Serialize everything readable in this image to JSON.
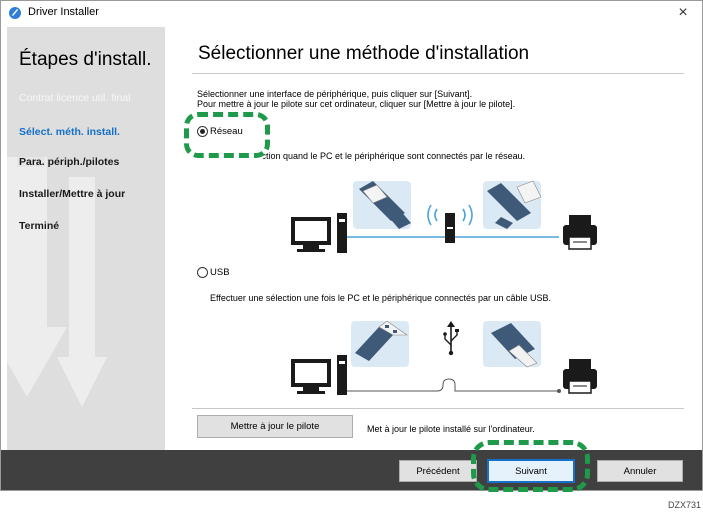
{
  "window": {
    "title": "Driver Installer",
    "close_glyph": "×"
  },
  "sidebar": {
    "heading": "Étapes d'install.",
    "steps": [
      {
        "label": "Contrat licence util. final",
        "state": "done"
      },
      {
        "label": "Sélect. méth. install.",
        "state": "current"
      },
      {
        "label": "Para. périph./pilotes",
        "state": "pending"
      },
      {
        "label": "Installer/Mettre à jour",
        "state": "pending"
      },
      {
        "label": "Terminé",
        "state": "pending"
      }
    ]
  },
  "main": {
    "title": "Sélectionner une méthode d'installation",
    "instruction_1": "Sélectionner une interface de périphérique, puis cliquer sur [Suivant].",
    "instruction_2": "Pour mettre à jour le pilote sur cet ordinateur, cliquer sur [Mettre à jour le pilote].",
    "options": [
      {
        "label": "Réseau",
        "checked": true,
        "description": "...ection quand le PC et le périphérique sont connectés par le réseau."
      },
      {
        "label": "USB",
        "checked": false,
        "description": "Effectuer une sélection une fois le PC et le périphérique connectés par un câble USB."
      }
    ],
    "update_button": "Mettre à jour le pilote",
    "update_description": "Met à jour le pilote installé sur l'ordinateur."
  },
  "footer": {
    "previous": "Précédent",
    "next": "Suivant",
    "cancel": "Annuler"
  },
  "figure_code": "DZX731",
  "colors": {
    "accent_blue": "#1470c8",
    "highlight_green": "#1e9a4a",
    "footer_bg": "#404040",
    "sidebar_bg": "#dedede",
    "cable_blue": "#3e5a78"
  },
  "icons": [
    "app-icon",
    "close-icon",
    "computer-icon",
    "printer-icon",
    "ethernet-plug-icon",
    "wifi-router-icon",
    "usb-plug-icon",
    "usb-symbol-icon"
  ]
}
